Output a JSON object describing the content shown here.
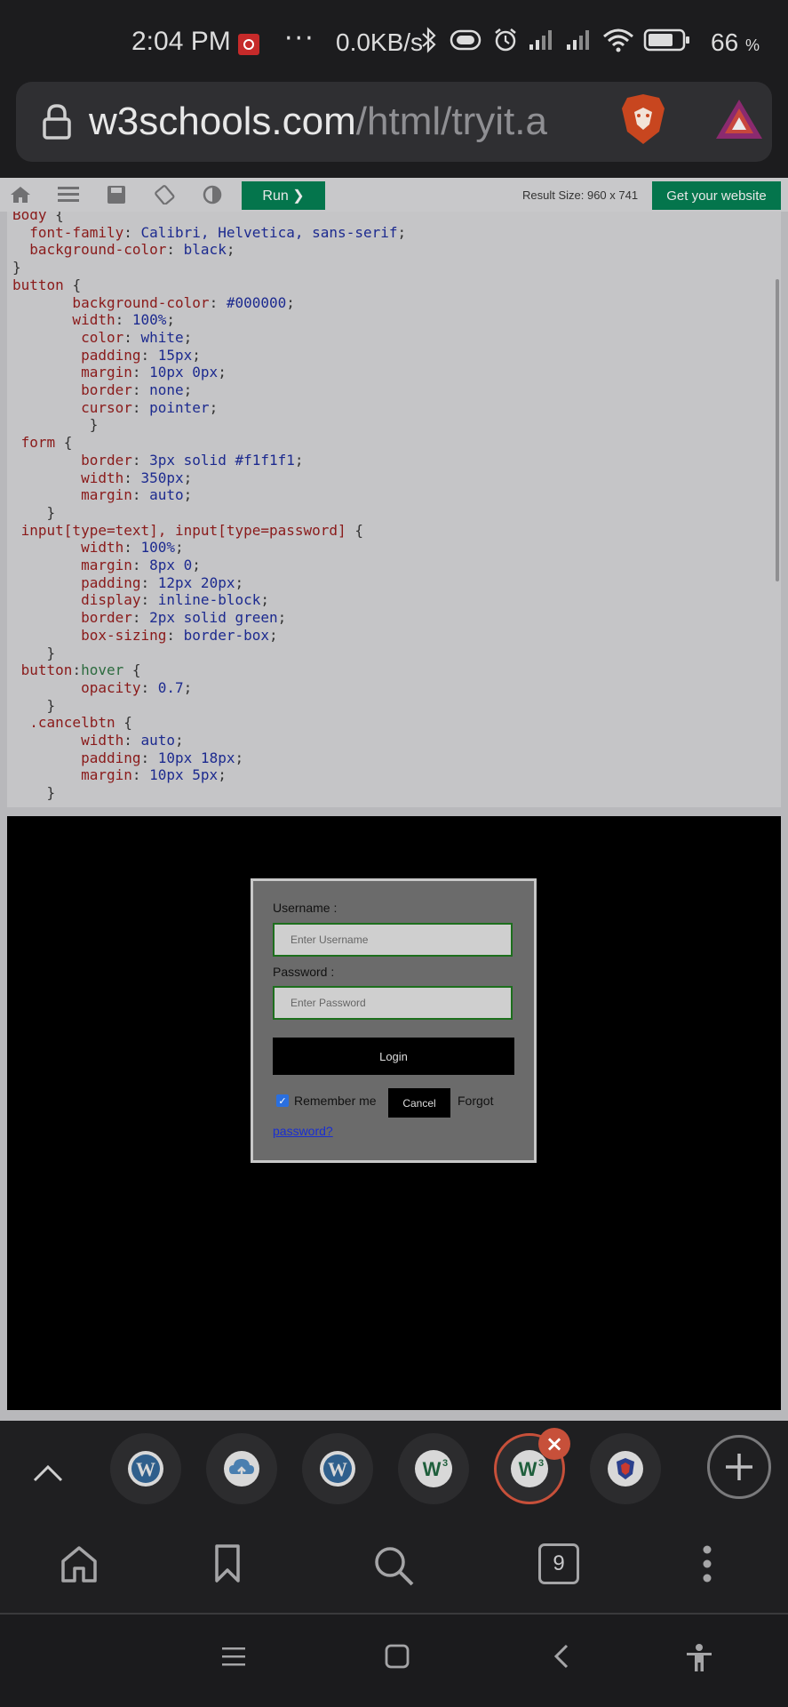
{
  "status_bar": {
    "time": "2:04 PM",
    "dots": "···",
    "speed": "0.0KB/s",
    "battery_percent": "66",
    "battery_unit": "%",
    "icons": [
      "recording-icon",
      "bluetooth-icon",
      "vibrate-icon",
      "alarm-icon",
      "signal-icon",
      "signal-icon",
      "wifi-icon",
      "battery-icon"
    ]
  },
  "url_bar": {
    "domain": "w3schools.com",
    "path": "/html/tryit.a"
  },
  "tryit_toolbar": {
    "run_label": "Run ❯",
    "result_size": "Result Size: 960 x 741",
    "get_website_label": "Get your website"
  },
  "code": {
    "lines": [
      "Body {",
      "  font-family: Calibri, Helvetica, sans-serif;",
      "  background-color: black;",
      "}",
      "button {",
      "       background-color: #000000;",
      "       width: 100%;",
      "        color: white;",
      "        padding: 15px;",
      "        margin: 10px 0px;",
      "        border: none;",
      "        cursor: pointer;",
      "         }",
      " form {",
      "        border: 3px solid #f1f1f1;",
      "        width: 350px;",
      "        margin: auto;",
      "    }",
      " input[type=text], input[type=password] {",
      "        width: 100%;",
      "        margin: 8px 0;",
      "        padding: 12px 20px;",
      "        display: inline-block;",
      "        border: 2px solid green;",
      "        box-sizing: border-box;",
      "    }",
      " button:hover {",
      "        opacity: 0.7;",
      "    }",
      "  .cancelbtn {",
      "        width: auto;",
      "        padding: 10px 18px;",
      "        margin: 10px 5px;",
      "    }"
    ]
  },
  "login_form": {
    "username_label": "Username :",
    "username_placeholder": "Enter Username",
    "password_label": "Password :",
    "password_placeholder": "Enter Password",
    "login_button": "Login",
    "remember_label": "Remember me",
    "remember_checked": true,
    "cancel_button": "Cancel",
    "forgot_text": "Forgot",
    "password_link": "password?"
  },
  "tab_strip": {
    "tabs": [
      {
        "icon": "wordpress-icon"
      },
      {
        "icon": "cloud-upload-icon"
      },
      {
        "icon": "wordpress-icon"
      },
      {
        "icon": "w3schools-icon"
      },
      {
        "icon": "w3schools-icon",
        "active": true
      },
      {
        "icon": "shield-icon"
      }
    ]
  },
  "bottom_bar": {
    "tab_count": "9"
  },
  "colors": {
    "w3_green": "#04754c",
    "active_tab_ring": "#c7503a",
    "input_border": "#1d6f1d",
    "link_blue": "#1a2fd0"
  }
}
